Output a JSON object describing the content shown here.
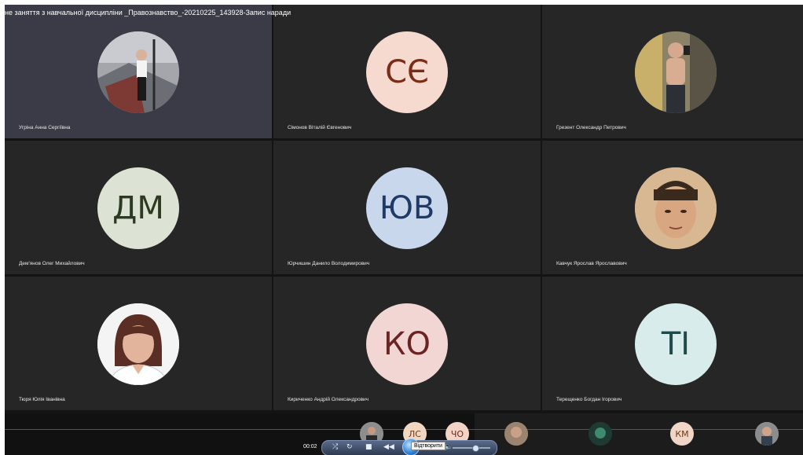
{
  "window": {
    "title": "не заняття з навчальної дисципліни _Правознавство_-20210225_143928-Запис наради"
  },
  "participants": [
    {
      "name": "Угріна Анна Сергіївна",
      "initials": "",
      "photo": "photo-woman-stairs",
      "bg": "#8a8a8a",
      "fg": "#000000",
      "active": true
    },
    {
      "name": "Сімонов Віталій Євгенович",
      "initials": "СЄ",
      "photo": "",
      "bg": "#f6d9cf",
      "fg": "#7a2c17",
      "active": false
    },
    {
      "name": "Грезент Олександр Петрович",
      "initials": "",
      "photo": "photo-man-gym",
      "bg": "#7b7361",
      "fg": "#000000",
      "active": false
    },
    {
      "name": "Дем'янов Олег Михайлович",
      "initials": "ДМ",
      "photo": "",
      "bg": "#dde3d4",
      "fg": "#2d3a22",
      "active": false
    },
    {
      "name": "Юрчишин Данило Володимирович",
      "initials": "ЮВ",
      "photo": "",
      "bg": "#c9d7ec",
      "fg": "#1e3a66",
      "active": false
    },
    {
      "name": "Кавчук Ярослав Ярославович",
      "initials": "",
      "photo": "photo-young-man",
      "bg": "#caa27a",
      "fg": "#000000",
      "active": false
    },
    {
      "name": "Тюря Юлія Іванівна",
      "initials": "",
      "photo": "photo-woman-portrait",
      "bg": "#f2f2f2",
      "fg": "#000000",
      "active": false
    },
    {
      "name": "Кириченко Андрій Олександрович",
      "initials": "КО",
      "photo": "",
      "bg": "#f2d6d3",
      "fg": "#6b2424",
      "active": false
    },
    {
      "name": "Терещенко Богдан Ігорович",
      "initials": "ТІ",
      "photo": "",
      "bg": "#d8ecec",
      "fg": "#1f4a4a",
      "active": false
    }
  ],
  "strip": [
    {
      "initials": "",
      "photo": "photo-small-1",
      "bg": "#8d8d8d",
      "fg": "#000"
    },
    {
      "initials": "ЛС",
      "photo": "",
      "bg": "#f1d7c2",
      "fg": "#6b3a1a"
    },
    {
      "initials": "ЧО",
      "photo": "",
      "bg": "#f2d3c6",
      "fg": "#6b2a1a"
    },
    {
      "initials": "",
      "photo": "photo-small-2",
      "bg": "#9a8470",
      "fg": "#000"
    },
    {
      "initials": "",
      "photo": "photo-small-3",
      "bg": "#1f3a33",
      "fg": "#000"
    },
    {
      "initials": "КМ",
      "photo": "",
      "bg": "#f1d6c8",
      "fg": "#6b3a1a"
    },
    {
      "initials": "",
      "photo": "photo-small-4",
      "bg": "#8c8c8c",
      "fg": "#000"
    }
  ],
  "player": {
    "time": "00:02",
    "tooltip": "Відтворити",
    "volume": 0.55,
    "icons": [
      "shuffle-icon",
      "repeat-icon",
      "stop-icon",
      "previous-icon",
      "play-icon",
      "next-icon",
      "volume-icon"
    ]
  }
}
